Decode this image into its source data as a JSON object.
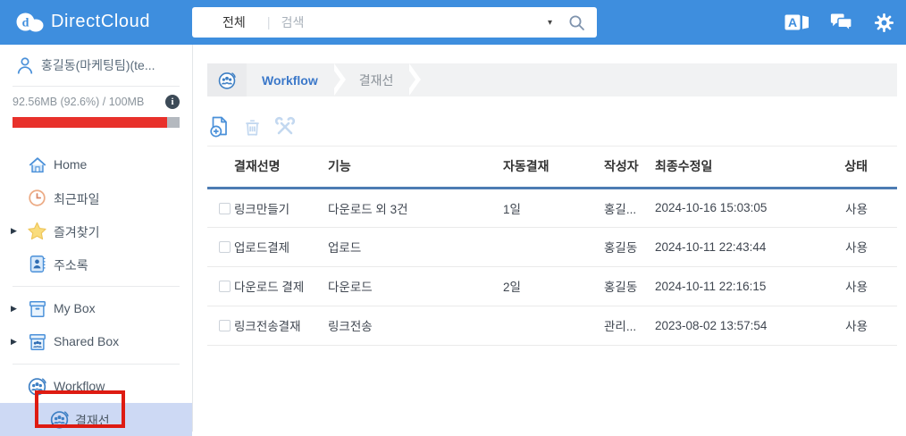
{
  "topbar": {
    "logo_text": "DirectCloud",
    "search": {
      "category": "전체",
      "placeholder": "검색"
    }
  },
  "sidebar": {
    "user_name": "홍길동(마케팅팀)(te...",
    "storage_text": "92.56MB (92.6%) / 100MB",
    "storage_percent": 92.6,
    "nav": {
      "home": "Home",
      "recent_files": "최근파일",
      "favorites": "즐겨찾기",
      "address_book": "주소록",
      "my_box": "My Box",
      "shared_box": "Shared Box",
      "workflow": "Workflow",
      "approval_line": "결재선"
    }
  },
  "breadcrumb": {
    "root": "Workflow",
    "current": "결재선"
  },
  "table": {
    "headers": [
      "결재선명",
      "기능",
      "자동결재",
      "작성자",
      "최종수정일",
      "상태"
    ],
    "rows": [
      {
        "name": "링크만들기",
        "function": "다운로드 외 3건",
        "auto_approval": "1일",
        "author": "홍길...",
        "modified": "2024-10-16 15:03:05",
        "status": "사용"
      },
      {
        "name": "업로드결제",
        "function": "업로드",
        "auto_approval": "",
        "author": "홍길동",
        "modified": "2024-10-11 22:43:44",
        "status": "사용"
      },
      {
        "name": "다운로드 결제",
        "function": "다운로드",
        "auto_approval": "2일",
        "author": "홍길동",
        "modified": "2024-10-11 22:16:15",
        "status": "사용"
      },
      {
        "name": "링크전송결재",
        "function": "링크전송",
        "auto_approval": "",
        "author": "관리...",
        "modified": "2023-08-02 13:57:54",
        "status": "사용"
      }
    ]
  },
  "colors": {
    "topbar_blue": "#3e8ede",
    "accent_blue": "#4a90d9",
    "sidebar_highlight": "#cdd9f4",
    "annotation_red": "#de1b12",
    "progress_red": "#e8312b",
    "header_underline": "#4d7cb3"
  }
}
